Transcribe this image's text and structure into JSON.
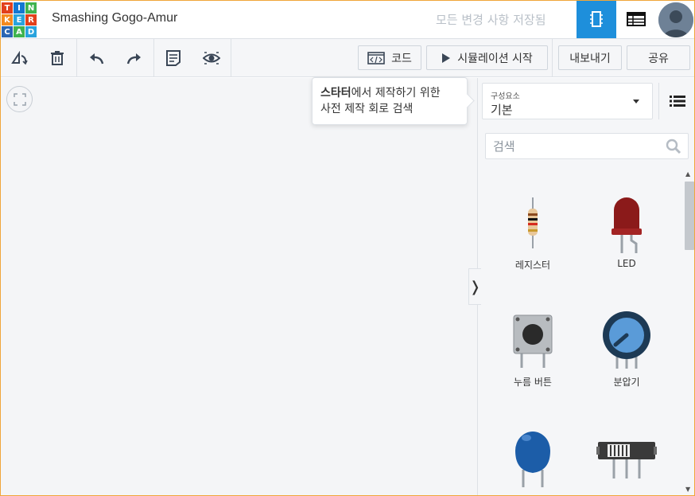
{
  "header": {
    "logo_letters": [
      "T",
      "I",
      "N",
      "K",
      "E",
      "R",
      "C",
      "A",
      "D"
    ],
    "title": "Smashing Gogo-Amur",
    "save_status": "모든 변경 사항 저장됨"
  },
  "toolbar": {
    "code_label": "코드",
    "simulate_label": "시뮬레이션 시작",
    "export_label": "내보내기",
    "share_label": "공유"
  },
  "tooltip": {
    "bold": "스타터",
    "line1_rest": "에서 제작하기 위한",
    "line2": "사전 제작 회로 검색"
  },
  "panel": {
    "dropdown_label": "구성요소",
    "dropdown_value": "기본",
    "search_placeholder": "검색",
    "components": [
      {
        "label": "레지스터",
        "icon": "resistor-icon"
      },
      {
        "label": "LED",
        "icon": "led-icon"
      },
      {
        "label": "누름 버튼",
        "icon": "pushbutton-icon"
      },
      {
        "label": "분압기",
        "icon": "potentiometer-icon"
      },
      {
        "label": "",
        "icon": "capacitor-icon"
      },
      {
        "label": "",
        "icon": "slide-switch-icon"
      }
    ]
  },
  "colors": {
    "accent": "#1e8fdb",
    "led_red": "#8b1a1a",
    "capacitor_blue": "#1c5da8"
  }
}
